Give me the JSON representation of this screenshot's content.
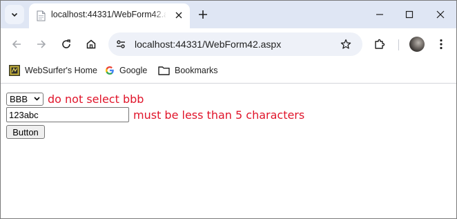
{
  "tab": {
    "title": "localhost:44331/WebForm42.aspx"
  },
  "toolbar": {
    "url": "localhost:44331/WebForm42.aspx"
  },
  "bookmarks": {
    "items": [
      {
        "label": "WebSurfer's Home",
        "icon": "websurfer-logo-icon"
      },
      {
        "label": "Google",
        "icon": "google-icon"
      },
      {
        "label": "Bookmarks",
        "icon": "folder-icon"
      }
    ]
  },
  "form": {
    "dropdown_value": "BBB",
    "dropdown_error": "do not select bbb",
    "textbox_value": "123abc",
    "textbox_error": "must be less than 5 characters",
    "button_label": "Button"
  },
  "colors": {
    "tabstrip": "#dfe6f4",
    "validator_text": "#e0142a",
    "omnibox": "#eef1f8"
  }
}
